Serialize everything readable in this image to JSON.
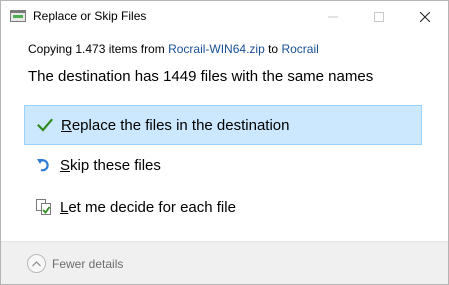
{
  "window": {
    "title": "Replace or Skip Files"
  },
  "copying": {
    "prefix": "Copying 1.473 items from ",
    "source": "Rocrail-WIN64.zip",
    "to_word": " to ",
    "destination": "Rocrail"
  },
  "headline": "The destination has 1449 files with the same names",
  "options": [
    {
      "accel": "R",
      "rest": "eplace the files in the destination",
      "icon": "checkmark-icon",
      "selected": true
    },
    {
      "accel": "S",
      "rest": "kip these files",
      "icon": "skip-arrow-icon",
      "selected": false
    },
    {
      "accel": "L",
      "rest": "et me decide for each file",
      "icon": "compare-files-icon",
      "selected": false
    }
  ],
  "footer": {
    "details_label": "Fewer details"
  },
  "colors": {
    "selected_bg": "#cce8ff",
    "selected_border": "#99d1ff",
    "link": "#1a4f96",
    "check_green": "#2e8b1f",
    "skip_blue": "#2e7bd6"
  }
}
